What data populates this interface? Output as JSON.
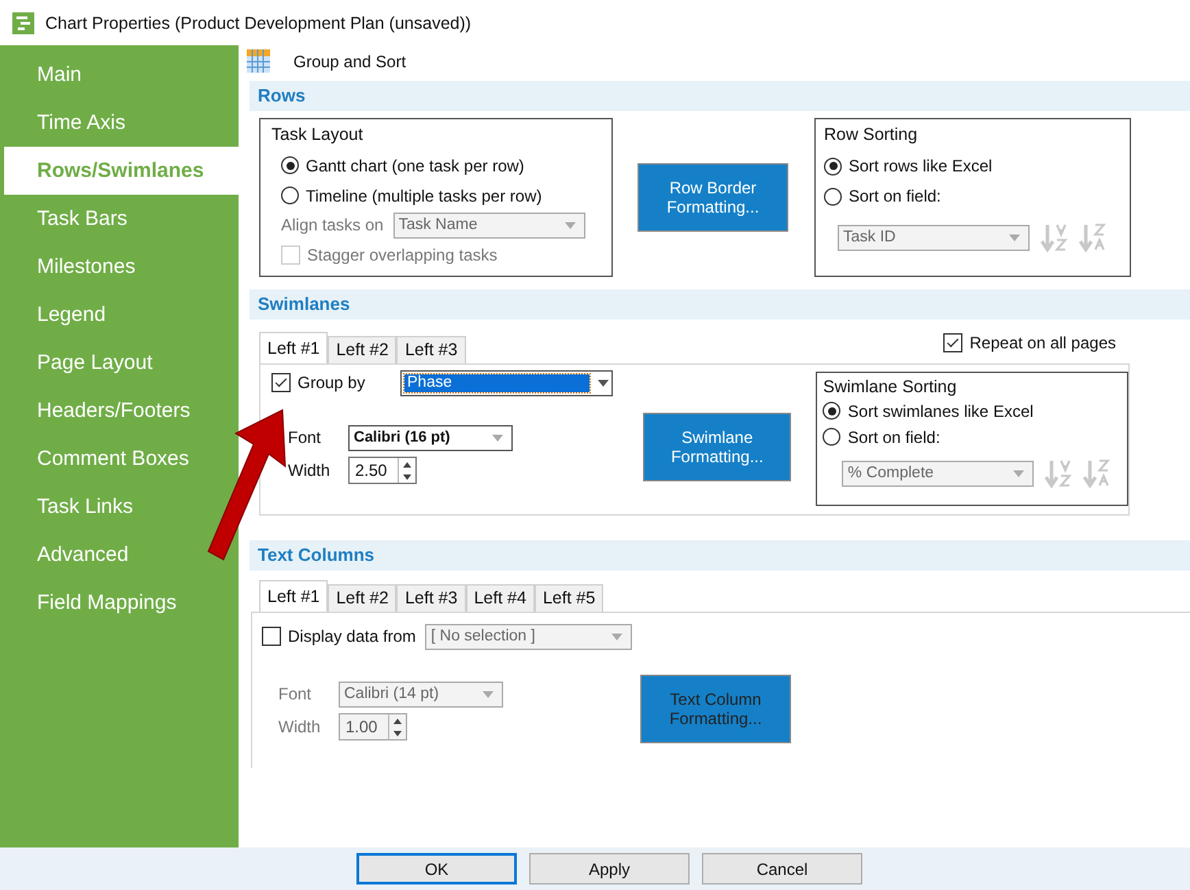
{
  "window": {
    "title": "Chart Properties (Product Development Plan (unsaved))"
  },
  "sidebar": {
    "items": [
      {
        "label": "Main",
        "selected": false
      },
      {
        "label": "Time Axis",
        "selected": false
      },
      {
        "label": "Rows/Swimlanes",
        "selected": true
      },
      {
        "label": "Task Bars",
        "selected": false
      },
      {
        "label": "Milestones",
        "selected": false
      },
      {
        "label": "Legend",
        "selected": false
      },
      {
        "label": "Page Layout",
        "selected": false
      },
      {
        "label": "Headers/Footers",
        "selected": false
      },
      {
        "label": "Comment Boxes",
        "selected": false
      },
      {
        "label": "Task Links",
        "selected": false
      },
      {
        "label": "Advanced",
        "selected": false
      },
      {
        "label": "Field Mappings",
        "selected": false
      }
    ]
  },
  "page_header": {
    "title": "Group and Sort"
  },
  "rows": {
    "title": "Rows",
    "task_layout": {
      "title": "Task Layout",
      "options": [
        {
          "label": "Gantt chart (one task per row)",
          "selected": true
        },
        {
          "label": "Timeline (multiple tasks per row)",
          "selected": false
        }
      ],
      "align": {
        "label": "Align tasks on",
        "value": "Task Name",
        "disabled": true
      },
      "stagger": {
        "label": "Stagger overlapping tasks",
        "checked": false,
        "disabled": true
      }
    },
    "button": "Row Border Formatting...",
    "sorting": {
      "title": "Row Sorting",
      "options": [
        {
          "label": "Sort rows like Excel",
          "selected": true
        },
        {
          "label": "Sort on field:",
          "selected": false
        }
      ],
      "field": {
        "value": "Task ID",
        "disabled": true
      }
    }
  },
  "swimlanes": {
    "title": "Swimlanes",
    "tabs": [
      {
        "label": "Left #1",
        "selected": true
      },
      {
        "label": "Left #2",
        "selected": false
      },
      {
        "label": "Left #3",
        "selected": false
      }
    ],
    "repeat": {
      "label": "Repeat on all pages",
      "checked": true
    },
    "group_by": {
      "label": "Group by",
      "checked": true,
      "value": "Phase",
      "highlighted": true
    },
    "font": {
      "label": "Font",
      "value": "Calibri (16 pt)",
      "disabled": false
    },
    "width": {
      "label": "Width",
      "value": "2.50",
      "disabled": false
    },
    "button": "Swimlane Formatting...",
    "sorting": {
      "title": "Swimlane Sorting",
      "options": [
        {
          "label": "Sort swimlanes like Excel",
          "selected": true
        },
        {
          "label": "Sort on field:",
          "selected": false
        }
      ],
      "field": {
        "value": "% Complete",
        "disabled": true
      }
    }
  },
  "text_columns": {
    "title": "Text Columns",
    "tabs": [
      {
        "label": "Left #1",
        "selected": true
      },
      {
        "label": "Left #2",
        "selected": false
      },
      {
        "label": "Left #3",
        "selected": false
      },
      {
        "label": "Left #4",
        "selected": false
      },
      {
        "label": "Left #5",
        "selected": false
      }
    ],
    "display": {
      "label": "Display data from",
      "checked": false,
      "value": "[ No selection ]",
      "disabled": true
    },
    "font": {
      "label": "Font",
      "value": "Calibri (14 pt)",
      "disabled": true
    },
    "width": {
      "label": "Width",
      "value": "1.00",
      "disabled": true
    },
    "button": "Text Column Formatting..."
  },
  "buttons": [
    {
      "label": "OK",
      "default": true
    },
    {
      "label": "Apply",
      "default": false
    },
    {
      "label": "Cancel",
      "default": false
    }
  ]
}
